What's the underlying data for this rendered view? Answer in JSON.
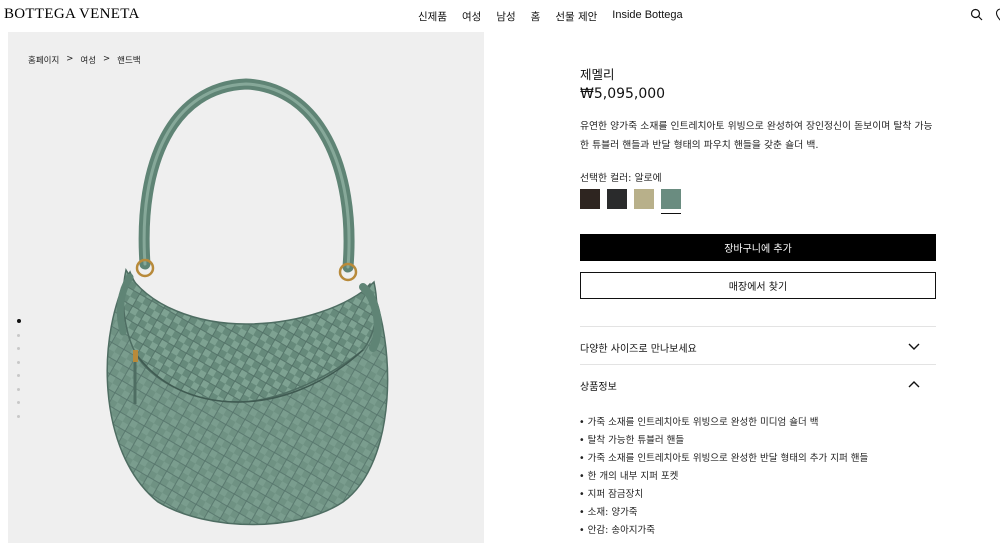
{
  "header": {
    "logo": "BOTTEGA VENETA",
    "nav": [
      "신제품",
      "여성",
      "남성",
      "홈",
      "선물 제안",
      "Inside Bottega"
    ],
    "icons": [
      "search-icon",
      "location-icon"
    ]
  },
  "breadcrumb": [
    "홈페이지",
    ">",
    "여성",
    ">",
    "핸드백"
  ],
  "gallery": {
    "image_count": 8,
    "active_index": 0
  },
  "product": {
    "name": "제멜리",
    "price": "₩5,095,000",
    "description": "유연한 양가죽 소재를 인트레치아토 위빙으로 완성하여 장인정신이 돋보이며 탈착 가능한 튜블러 핸들과 반달 형태의 파우치 핸들을 갖춘 숄더 백.",
    "color_label": "선택한 컬러: 알로에",
    "swatches": [
      {
        "name": "dark-brown",
        "color": "#2e2520"
      },
      {
        "name": "black",
        "color": "#2a2b2c"
      },
      {
        "name": "beige",
        "color": "#b8b08a"
      },
      {
        "name": "aloe",
        "color": "#6a8c80",
        "selected": true
      }
    ],
    "add_to_cart": "장바구니에 추가",
    "find_in_store": "매장에서 찾기"
  },
  "accordion": {
    "sizes": {
      "label": "다양한 사이즈로 만나보세요",
      "icon": "chevron-down-icon"
    },
    "details": {
      "label": "상품정보",
      "icon": "chevron-up-icon"
    }
  },
  "details_list": [
    "가죽 소재를 인트레치아토 위빙으로 완성한 미디엄 숄더 백",
    "탈착 가능한 튜블러 핸들",
    "가죽 소재를 인트레치아토 위빙으로 완성한 반달 형태의 추가 지퍼 핸들",
    "한 개의 내부 지퍼 포켓",
    "지퍼 잠금장치",
    "소재: 양가죽",
    "안감: 송아지가죽"
  ]
}
